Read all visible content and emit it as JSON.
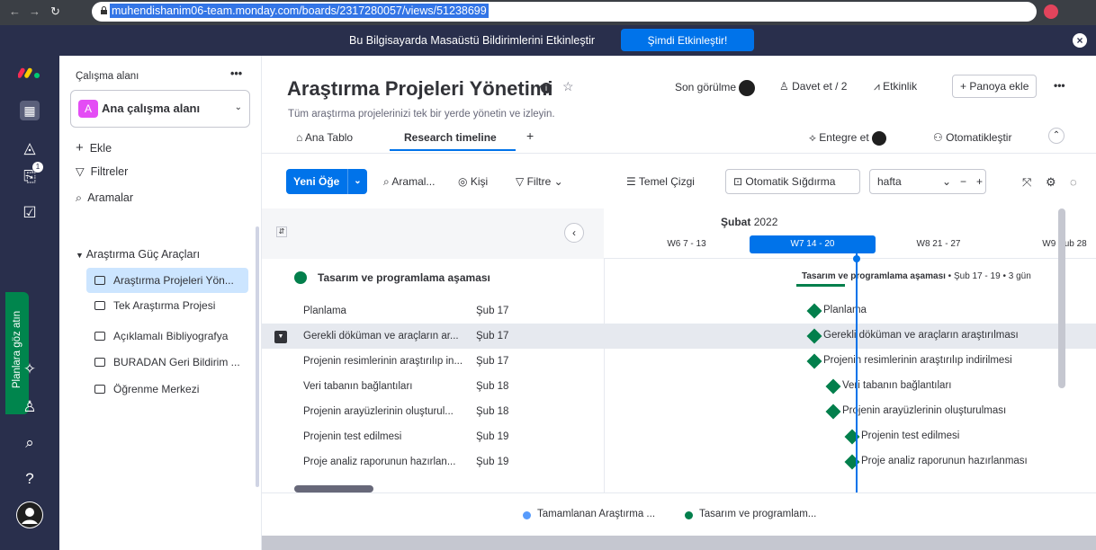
{
  "browser": {
    "url": "muhendishanim06-team.monday.com/boards/2317280057/views/51238699"
  },
  "notification": {
    "text": "Bu Bilgisayarda Masaüstü Bildirimlerini Etkinleştir",
    "button": "Şimdi Etkinleştir!"
  },
  "rail": {
    "planlara": "Planlara göz atın",
    "badge": "1"
  },
  "sidebar": {
    "workspace_label": "Çalışma alanı",
    "workspace_avatar": "A",
    "workspace_name": "Ana çalışma alanı",
    "add": "Ekle",
    "filters": "Filtreler",
    "searches": "Aramalar",
    "folder": "Araştırma Güç Araçları",
    "items": [
      {
        "label": "Araştırma Projeleri Yön..."
      },
      {
        "label": "Tek Araştırma Projesi"
      },
      {
        "label": "Açıklamalı Bibliyografya"
      },
      {
        "label": "BURADAN Geri Bildirim ..."
      },
      {
        "label": "Öğrenme Merkezi"
      }
    ]
  },
  "board": {
    "title": "Araştırma Projeleri Yönetimi",
    "subtitle": "Tüm araştırma projelerinizi tek bir yerde yönetin ve izleyin.",
    "last_seen": "Son görülme",
    "invite": "Davet et / 2",
    "activity": "Etkinlik",
    "add_to_board": "+ Panoya ekle",
    "tabs": [
      {
        "label": "Ana Tablo"
      },
      {
        "label": "Research timeline"
      }
    ],
    "integrate": "Entegre et",
    "automate": "Otomatikleştir"
  },
  "toolbar": {
    "new_item": "Yeni Öğe",
    "search": "Aramal...",
    "person": "Kişi",
    "filter": "Filtre",
    "baseline": "Temel Çizgi",
    "auto_fit": "Otomatik Sığdırma",
    "scale": "hafta"
  },
  "timeline": {
    "month": "Şubat",
    "year": "2022",
    "weeks": [
      {
        "label": "W6  7 - 13",
        "current": false
      },
      {
        "label": "W7  14 - 20",
        "current": true
      },
      {
        "label": "W8  21 - 27",
        "current": false
      },
      {
        "label": "W9  Şub 28",
        "current": false
      }
    ],
    "group_name": "Tasarım ve programlama aşaması",
    "group_summary": "Tasarım ve programlama aşaması",
    "group_summary_meta": "• Şub 17 - 19 • 3 gün",
    "tasks": [
      {
        "name": "Planlama",
        "date": "Şub 17",
        "full": "Planlama",
        "day": 17
      },
      {
        "name": "Gerekli döküman ve araçların ar...",
        "date": "Şub 17",
        "full": "Gerekli döküman ve araçların araştırılması",
        "day": 17
      },
      {
        "name": "Projenin resimlerinin araştırılıp in...",
        "date": "Şub 17",
        "full": "Projenin resimlerinin araştırılıp indirilmesi",
        "day": 17
      },
      {
        "name": "Veri tabanın bağlantıları",
        "date": "Şub 18",
        "full": "Veri tabanın bağlantıları",
        "day": 18
      },
      {
        "name": "Projenin arayüzlerinin oluşturul...",
        "date": "Şub 18",
        "full": "Projenin arayüzlerinin oluşturulması",
        "day": 18
      },
      {
        "name": "Projenin test edilmesi",
        "date": "Şub 19",
        "full": "Projenin test edilmesi",
        "day": 19
      },
      {
        "name": "Proje analiz raporunun hazırlan...",
        "date": "Şub 19",
        "full": "Proje analiz raporunun hazırlanması",
        "day": 19
      }
    ],
    "legend": [
      {
        "label": "Tamamlanan Araştırma ...",
        "color": "#579bfc"
      },
      {
        "label": "Tasarım ve programlam...",
        "color": "#037f4c"
      }
    ]
  }
}
